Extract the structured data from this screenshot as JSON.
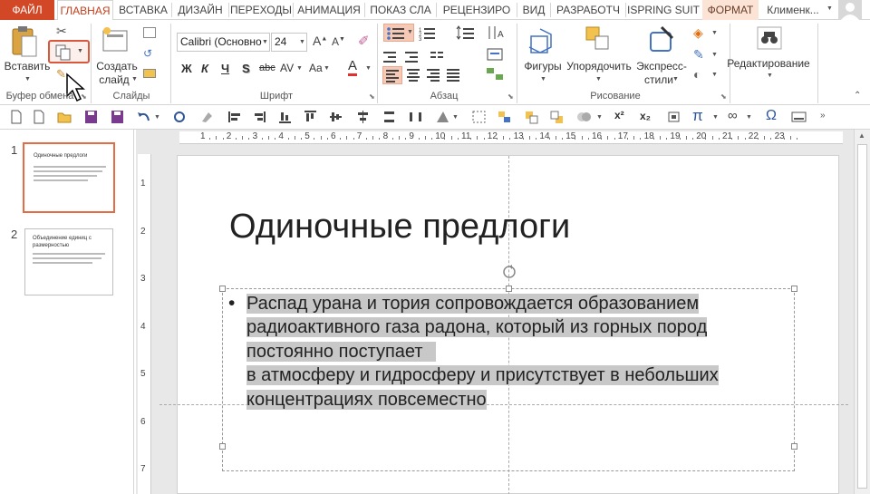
{
  "tabs": {
    "file": "ФАЙЛ",
    "home": "ГЛАВНАЯ",
    "insert": "ВСТАВКА",
    "design": "ДИЗАЙН",
    "transitions": "ПЕРЕХОДЫ",
    "animations": "АНИМАЦИЯ",
    "slideshow": "ПОКАЗ СЛА",
    "review": "РЕЦЕНЗИРО",
    "view": "ВИД",
    "developer": "РАЗРАБОТЧ",
    "ispring": "ISPRING SUIT",
    "format": "ФОРМАТ",
    "user": "Клименк..."
  },
  "ribbon": {
    "clipboard": {
      "paste": "Вставить",
      "group": "Буфер обмена"
    },
    "slides": {
      "new_slide_1": "Создать",
      "new_slide_2": "слайд",
      "group": "Слайды"
    },
    "font": {
      "family": "Calibri (Основно",
      "size": "24",
      "group": "Шрифт",
      "bold": "Ж",
      "italic": "К",
      "underline": "Ч",
      "shadow": "S",
      "strike": "abc",
      "spacing": "AV",
      "case": "Aa",
      "color": "A"
    },
    "paragraph": {
      "group": "Абзац"
    },
    "drawing": {
      "shapes": "Фигуры",
      "arrange": "Упорядочить",
      "quick_1": "Экспресс-",
      "quick_2": "стили",
      "group": "Рисование"
    },
    "editing": {
      "label": "Редактирование"
    }
  },
  "qat_symbols": {
    "sup": "x²",
    "sub": "x₂",
    "pi": "π",
    "infinity": "∞",
    "omega": "Ω"
  },
  "hruler_ticks": [
    "1",
    "2",
    "3",
    "4",
    "5",
    "6",
    "7",
    "8",
    "9",
    "10",
    "11",
    "12",
    "13",
    "14",
    "15",
    "16",
    "17",
    "18",
    "19",
    "20",
    "21",
    "22",
    "23"
  ],
  "vruler_ticks": [
    "1",
    "2",
    "3",
    "4",
    "5",
    "6",
    "7"
  ],
  "thumbnails": [
    {
      "num": "1",
      "title": "Одиночные предлоги",
      "selected": true
    },
    {
      "num": "2",
      "title": "Объединение единиц с размерностью",
      "selected": false
    }
  ],
  "slide": {
    "title": "Одиночные предлоги",
    "lines": [
      "Распад урана и тория сопровождается образованием",
      "радиоактивного газа радона, который из горных пород",
      "постоянно поступает ",
      "в атмосферу и гидросферу и присутствует в небольших",
      "концентрациях повсеместно"
    ],
    "bullet": "•"
  },
  "colors": {
    "accent": "#d24726",
    "tab_active": "#c43e1c",
    "highlight": "#c8c8c8",
    "selection": "#d9573a"
  }
}
